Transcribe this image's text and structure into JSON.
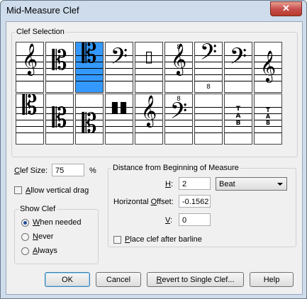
{
  "window": {
    "title": "Mid-Measure Clef",
    "close_label": "✕"
  },
  "clef_selection": {
    "label": "Clef Selection",
    "row1": [
      "treble",
      "alto",
      "tenor",
      "bass",
      "percussion",
      "treble-8va",
      "bass-8vb",
      "bass",
      "treble-low"
    ],
    "row2": [
      "c-clef-high",
      "c-clef",
      "c-clef-low",
      "percussion-double",
      "treble-8vb",
      "bass-8va",
      "blank",
      "tab",
      "tab-small"
    ],
    "octave_marks": {
      "treble_8va_label": "8",
      "bass_8vb_label": "8",
      "bass_8va_label": "8"
    },
    "tab_labels": [
      "T",
      "A",
      "B"
    ]
  },
  "clef_size": {
    "label_prefix": "C",
    "label_rest": "lef Size:",
    "value": "75",
    "unit": "%"
  },
  "allow_drag": {
    "label_prefix": "A",
    "label_rest": "llow vertical drag",
    "checked": false
  },
  "show_clef": {
    "label": "Show Clef",
    "options": [
      {
        "prefix": "W",
        "rest": "hen needed",
        "selected": true
      },
      {
        "prefix": "N",
        "rest": "ever",
        "selected": false
      },
      {
        "prefix": "A",
        "rest": "lways",
        "selected": false
      }
    ]
  },
  "distance": {
    "label": "Distance from Beginning of Measure",
    "h_label": "H",
    "h_value": "2",
    "unit": "Beat",
    "horiz_label_a": "Horizontal ",
    "horiz_label_u": "O",
    "horiz_label_b": "ffset:",
    "horiz_value": "-0.1562",
    "v_label": "V",
    "v_value": "0"
  },
  "after_barline": {
    "prefix": "P",
    "rest": "lace clef after barline",
    "checked": false
  },
  "buttons": {
    "ok": "OK",
    "cancel": "Cancel",
    "revert_prefix": "R",
    "revert_rest": "evert to Single Clef...",
    "help": "Help"
  }
}
